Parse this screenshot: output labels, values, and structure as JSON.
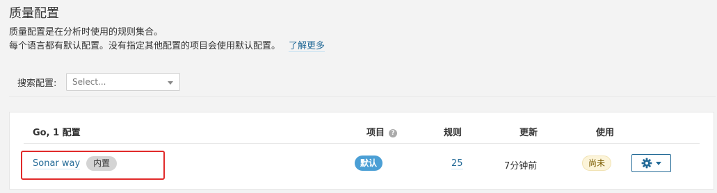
{
  "page": {
    "title": "质量配置",
    "description_line1": "质量配置是在分析时使用的规则集合。",
    "description_line2": "每个语言都有默认配置。没有指定其他配置的项目会使用默认配置。",
    "learn_more": "了解更多"
  },
  "search": {
    "label": "搜索配置:",
    "placeholder": "Select..."
  },
  "table": {
    "language_header": "Go, 1 配置",
    "columns": {
      "projects": "项目",
      "rules": "规则",
      "updated": "更新",
      "used": "使用"
    },
    "rows": [
      {
        "name": "Sonar way",
        "builtin_badge": "内置",
        "projects_badge": "默认",
        "rules": "25",
        "updated": "7分钟前",
        "used": "尚未"
      }
    ]
  },
  "colors": {
    "link": "#236a97",
    "default_badge": "#4b9fd5",
    "highlight": "#e12a2a"
  },
  "icons": {
    "help": "help-icon",
    "gear": "gear-icon",
    "dropdown": "chevron-down-icon"
  }
}
